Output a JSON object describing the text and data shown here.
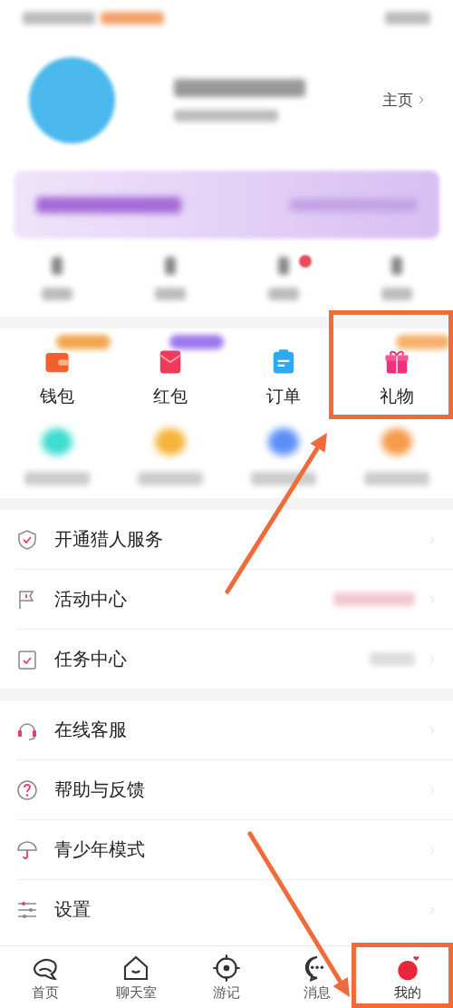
{
  "profile": {
    "home_link": "主页"
  },
  "shortcuts": [
    {
      "label": "钱包",
      "highlighted": false
    },
    {
      "label": "红包",
      "highlighted": false
    },
    {
      "label": "订单",
      "highlighted": false
    },
    {
      "label": "礼物",
      "highlighted": true
    }
  ],
  "menu_groups": [
    [
      {
        "label": "开通猎人服务"
      },
      {
        "label": "活动中心"
      },
      {
        "label": "任务中心"
      }
    ],
    [
      {
        "label": "在线客服"
      },
      {
        "label": "帮助与反馈"
      },
      {
        "label": "青少年模式"
      },
      {
        "label": "设置"
      }
    ]
  ],
  "tab_bar": [
    {
      "label": "首页",
      "selected": false,
      "highlighted": false
    },
    {
      "label": "聊天室",
      "selected": false,
      "highlighted": false
    },
    {
      "label": "游记",
      "selected": false,
      "highlighted": false
    },
    {
      "label": "消息",
      "selected": false,
      "highlighted": false
    },
    {
      "label": "我的",
      "selected": true,
      "highlighted": true
    }
  ]
}
